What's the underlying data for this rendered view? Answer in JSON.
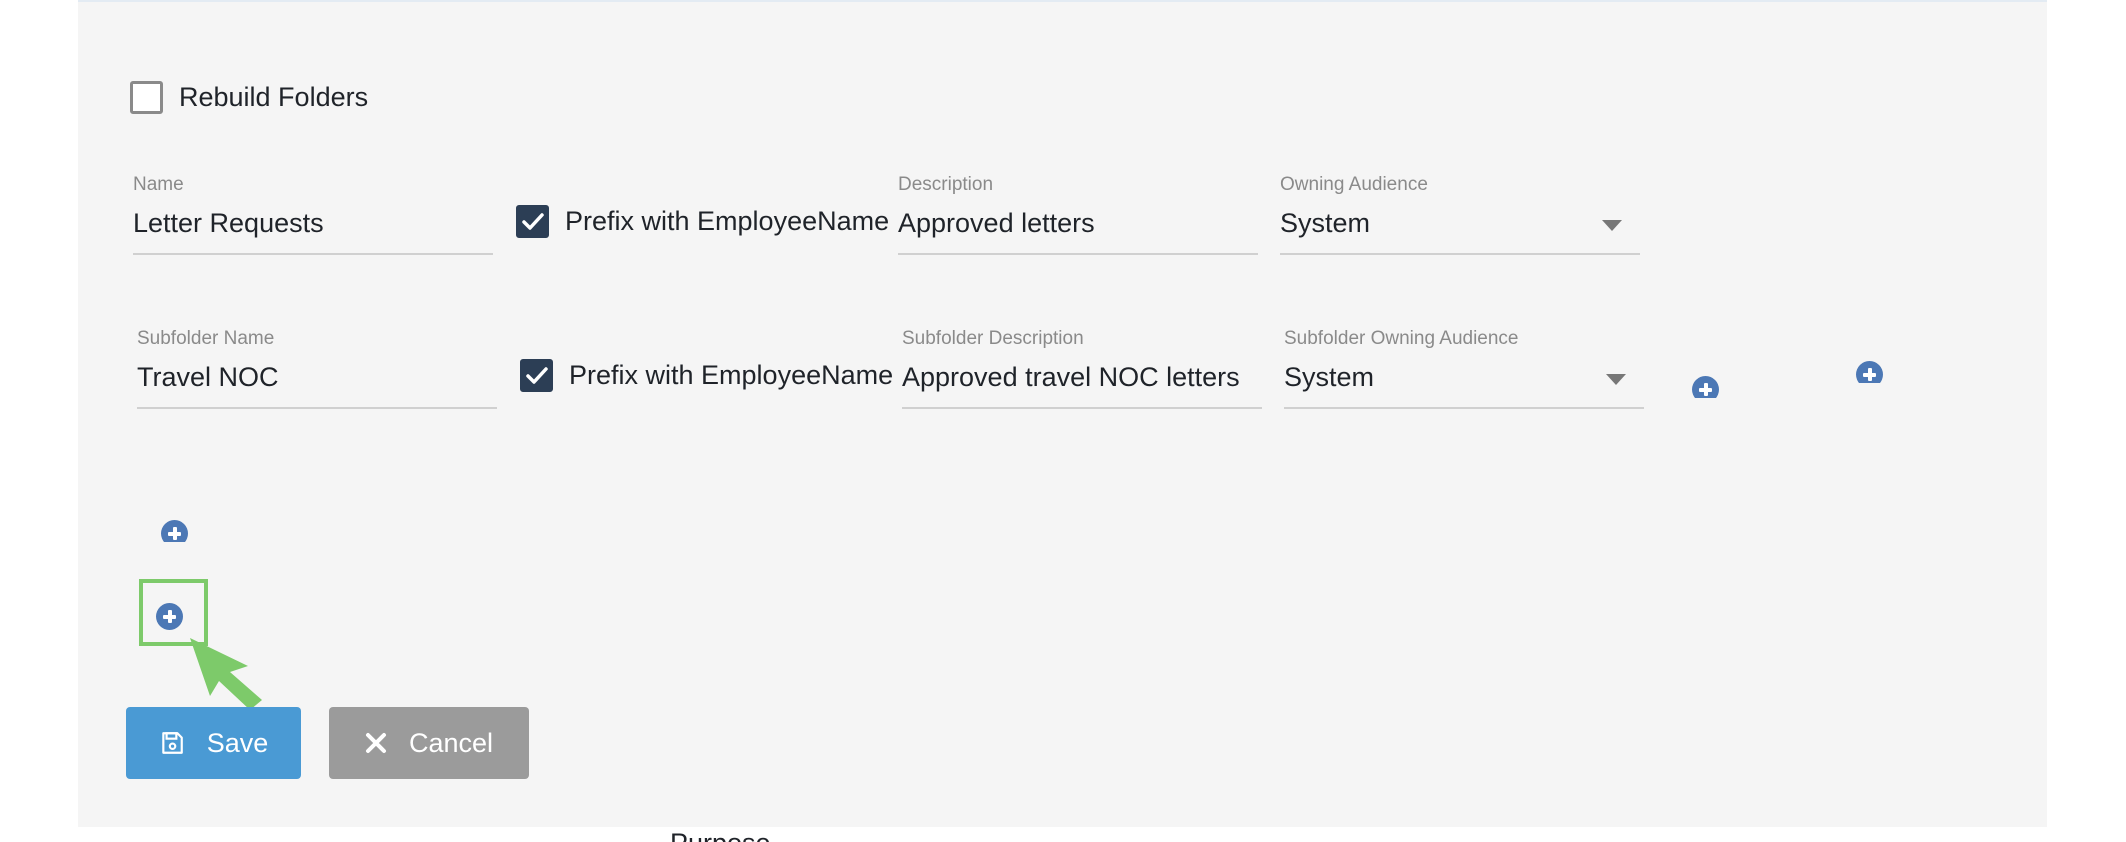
{
  "form": {
    "rebuild_folders": {
      "label": "Rebuild Folders",
      "checked": false
    },
    "name": {
      "label": "Name",
      "value": "Letter Requests"
    },
    "prefix_employee_name": {
      "label": "Prefix with EmployeeName",
      "checked": true
    },
    "description": {
      "label": "Description",
      "value": "Approved letters"
    },
    "owning_audience": {
      "label": "Owning Audience",
      "value": "System"
    },
    "subfolder": {
      "name": {
        "label": "Subfolder Name",
        "value": "Travel NOC"
      },
      "prefix_employee_name": {
        "label": "Prefix with EmployeeName",
        "checked": true
      },
      "description": {
        "label": "Subfolder Description",
        "value": "Approved travel NOC letters"
      },
      "owning_audience": {
        "label": "Subfolder Owning Audience",
        "value": "System"
      }
    }
  },
  "icons": {
    "add": "plus-circle-icon",
    "save": "floppy-disk-icon",
    "cancel": "x-icon",
    "pointer": "cursor-arrow-icon"
  },
  "colors": {
    "accent": "#4c78b5",
    "save_button": "#4a9ad4",
    "cancel_button": "#9b9b9b",
    "checkbox_checked": "#2c3e55",
    "highlight": "#7dca6a"
  },
  "actions": {
    "save_label": "Save",
    "cancel_label": "Cancel"
  },
  "below_panel": {
    "purpose_label": "Purpose"
  }
}
